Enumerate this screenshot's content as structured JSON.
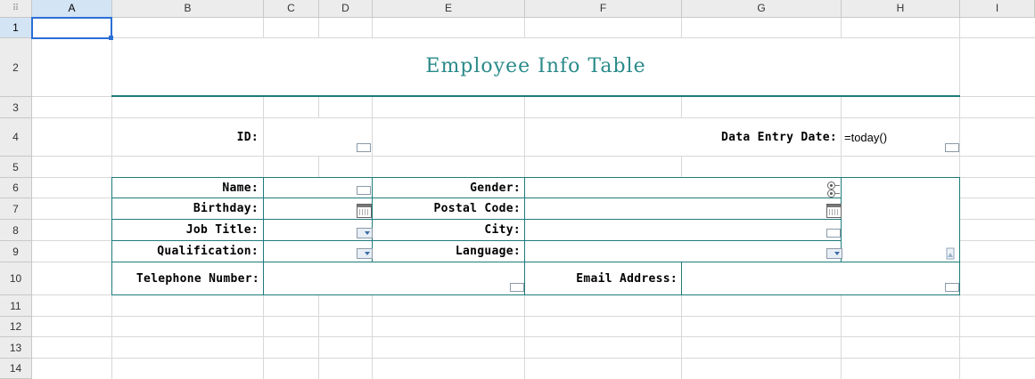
{
  "columns": [
    "A",
    "B",
    "C",
    "D",
    "E",
    "F",
    "G",
    "H",
    "I"
  ],
  "rows": [
    "1",
    "2",
    "3",
    "4",
    "5",
    "6",
    "7",
    "8",
    "9",
    "10",
    "11",
    "12",
    "13",
    "14"
  ],
  "corner_icon": "select-all-grip",
  "selected_cell": "A1",
  "form": {
    "title": "Employee Info Table",
    "id_label": "ID:",
    "data_entry_date_label": "Data Entry Date:",
    "data_entry_date_value": "=today()",
    "name_label": "Name:",
    "gender_label": "Gender:",
    "birthday_label": "Birthday:",
    "postal_code_label": "Postal Code:",
    "job_title_label": "Job Title:",
    "city_label": "City:",
    "qualification_label": "Qualification:",
    "language_label": "Language:",
    "telephone_label": "Telephone Number:",
    "email_label": "Email Address:"
  },
  "colors": {
    "accent": "#1e7b7b",
    "title": "#2a8a8a",
    "selection": "#2a6fd6"
  }
}
